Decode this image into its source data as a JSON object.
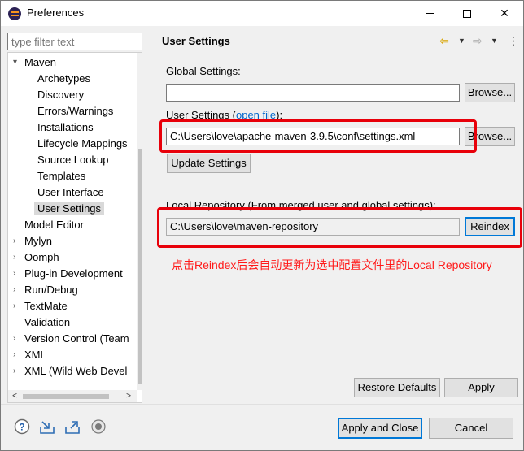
{
  "window": {
    "title": "Preferences",
    "minimize": "—",
    "maximize": "☐",
    "close": "✕"
  },
  "filter": {
    "placeholder": "type filter text"
  },
  "tree": {
    "maven": {
      "label": "Maven",
      "children": [
        "Archetypes",
        "Discovery",
        "Errors/Warnings",
        "Installations",
        "Lifecycle Mappings",
        "Source Lookup",
        "Templates",
        "User Interface",
        "User Settings"
      ]
    },
    "others": [
      "Model Editor",
      "Mylyn",
      "Oomph",
      "Plug-in Development",
      "Run/Debug",
      "TextMate",
      "Validation",
      "Version Control (Team",
      "XML",
      "XML (Wild Web Devel"
    ]
  },
  "page": {
    "title": "User Settings",
    "global_label": "Global Settings:",
    "global_value": "",
    "browse1": "Browse...",
    "user_label_prefix": "User Settings (",
    "user_link": "open file",
    "user_label_suffix": "):",
    "user_value": "C:\\Users\\love\\apache-maven-3.9.5\\conf\\settings.xml",
    "browse2": "Browse...",
    "update": "Update Settings",
    "local_label": "Local Repository (From merged user and global settings):",
    "local_value": "C:\\Users\\love\\maven-repository",
    "reindex": "Reindex",
    "annotation": "点击Reindex后会自动更新为选中配置文件里的Local Repository",
    "restore": "Restore Defaults",
    "apply": "Apply"
  },
  "footer": {
    "apply_close": "Apply and Close",
    "cancel": "Cancel"
  },
  "colors": {
    "highlight": "#e8000a",
    "link": "#0066cc",
    "default_button": "#0078d7"
  }
}
